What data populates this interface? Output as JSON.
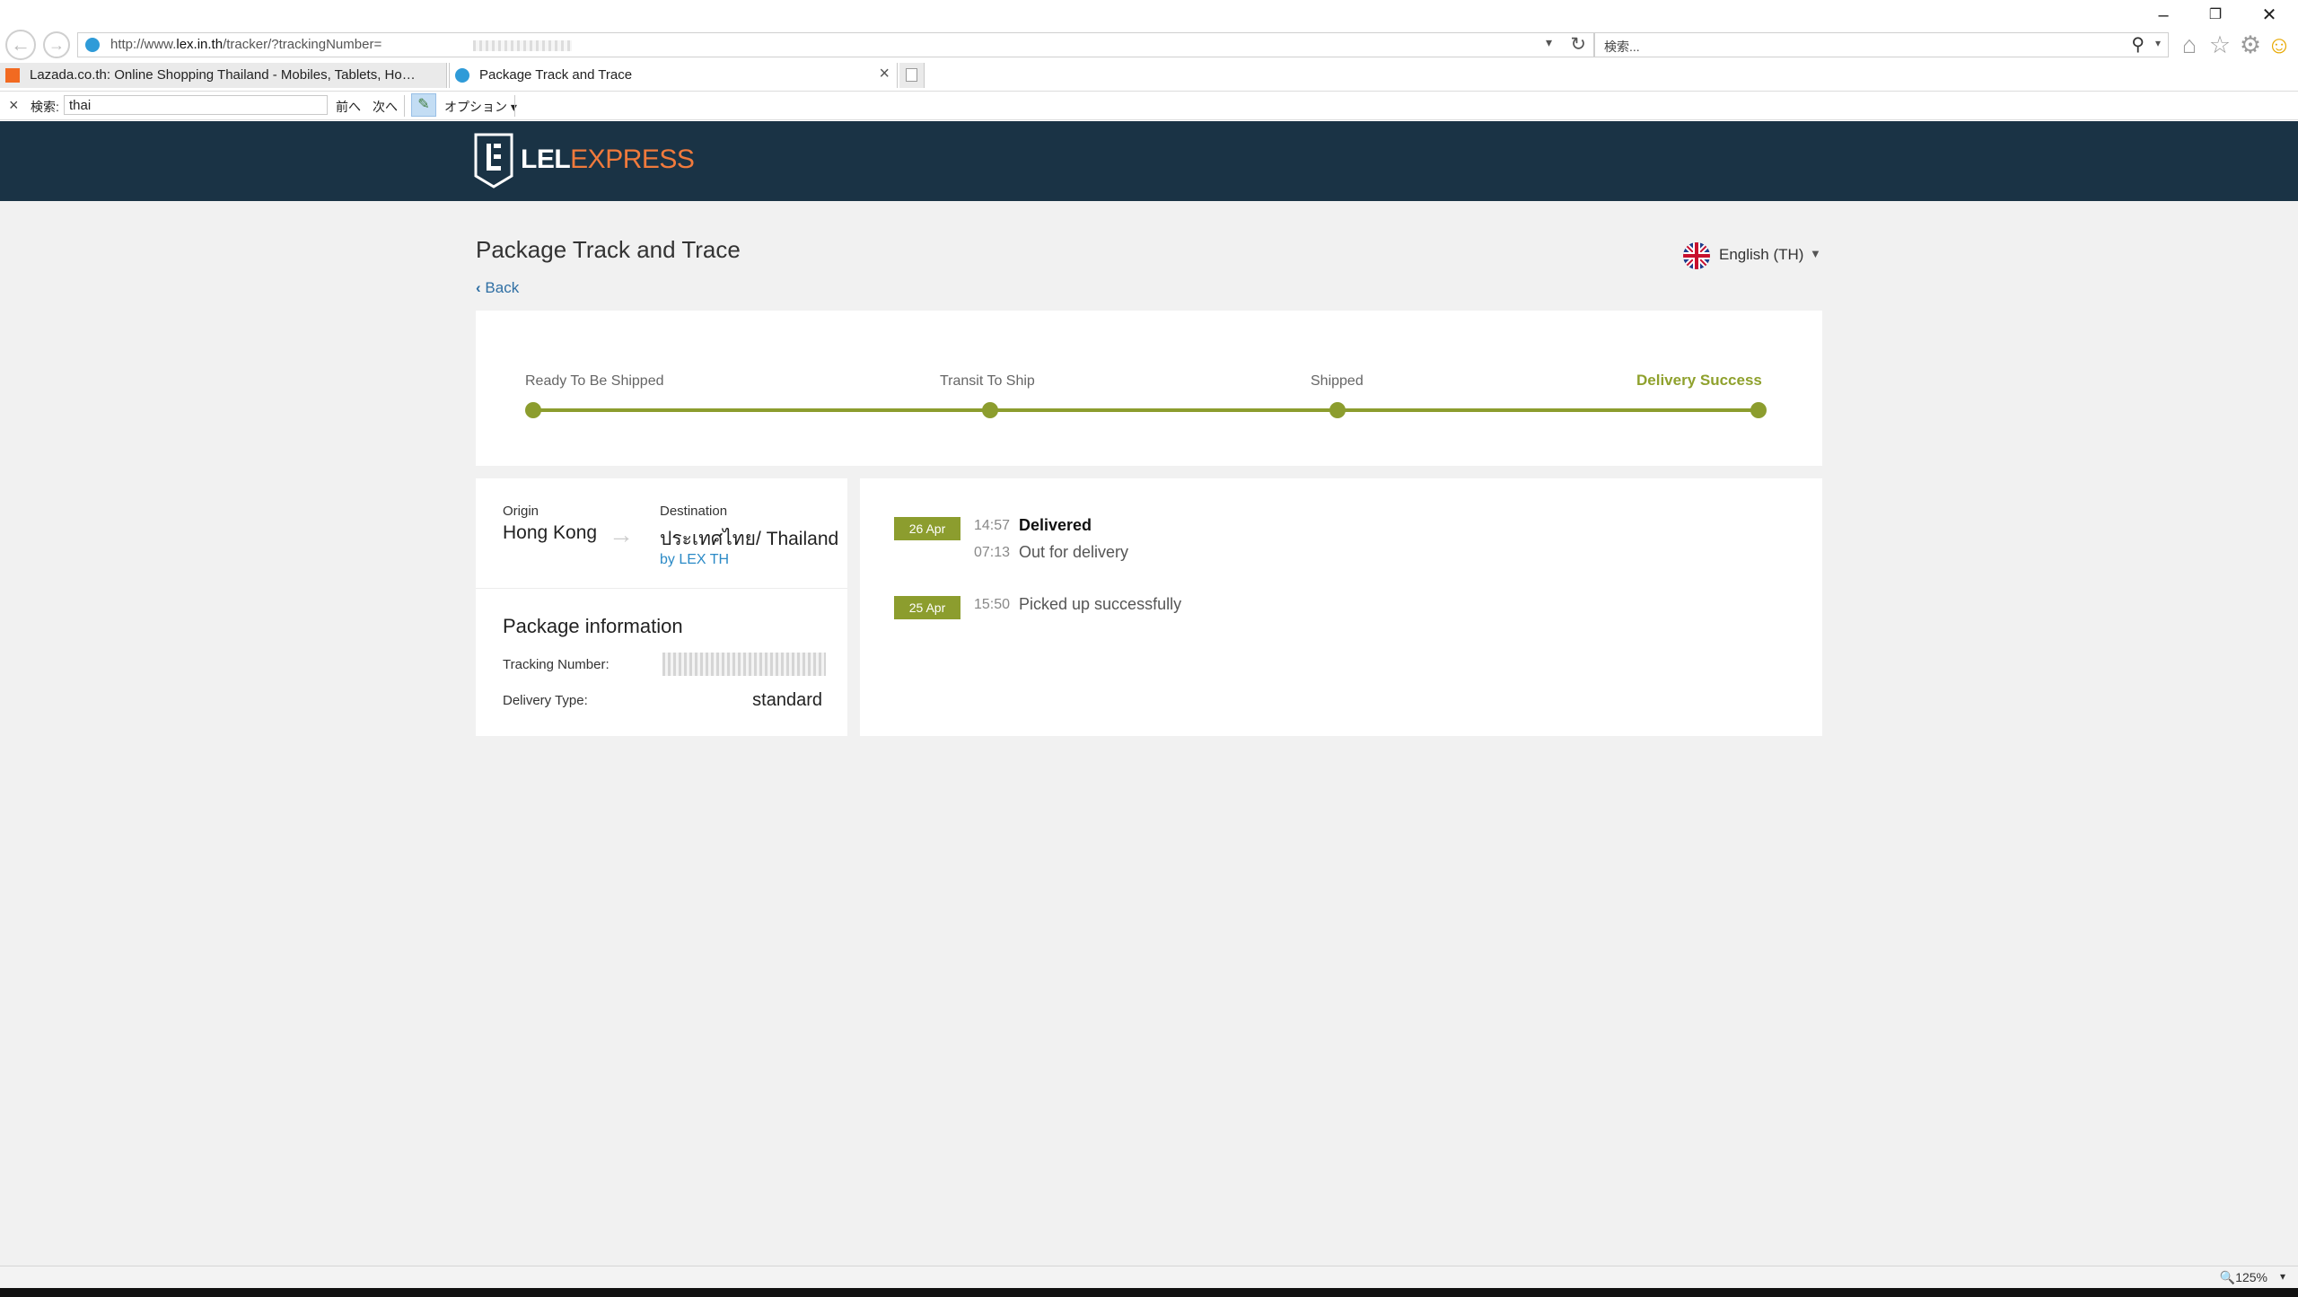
{
  "browser": {
    "url_prefix": "http://www.",
    "url_host": "lex.in.th",
    "url_path": "/tracker/?trackingNumber=",
    "search_placeholder": "検索...",
    "tabs": [
      {
        "label": "Lazada.co.th: Online Shopping Thailand - Mobiles, Tablets, Home Ap..."
      },
      {
        "label": "Package Track and Trace"
      }
    ],
    "find": {
      "label": "検索:",
      "query": "thai",
      "prev": "前へ",
      "next": "次へ",
      "options": "オプション"
    },
    "zoom": "125%"
  },
  "header": {
    "logo_part1": "LEL",
    "logo_part2": "EXPRESS"
  },
  "page": {
    "title": "Package Track and Trace",
    "back": "Back",
    "language": "English (TH)"
  },
  "progress": {
    "steps": [
      {
        "label": "Ready To Be Shipped"
      },
      {
        "label": "Transit To Ship"
      },
      {
        "label": "Shipped"
      },
      {
        "label": "Delivery Success"
      }
    ]
  },
  "route": {
    "origin_label": "Origin",
    "origin": "Hong Kong",
    "destination_label": "Destination",
    "destination": "ประเทศไทย/ Thailand",
    "carrier": "by LEX TH"
  },
  "package": {
    "heading": "Package information",
    "tracking_label": "Tracking Number:",
    "delivery_type_label": "Delivery Type:",
    "delivery_type": "standard"
  },
  "events": [
    {
      "date": "26 Apr",
      "time": "14:57",
      "text": "Delivered"
    },
    {
      "time": "07:13",
      "text": "Out for delivery"
    },
    {
      "date": "25 Apr",
      "time": "15:50",
      "text": "Picked up successfully"
    }
  ],
  "colors": {
    "header_bg": "#1a3345",
    "accent_green": "#8c9d2e",
    "logo_orange": "#f07a3c",
    "link_blue": "#2f6fa4"
  }
}
